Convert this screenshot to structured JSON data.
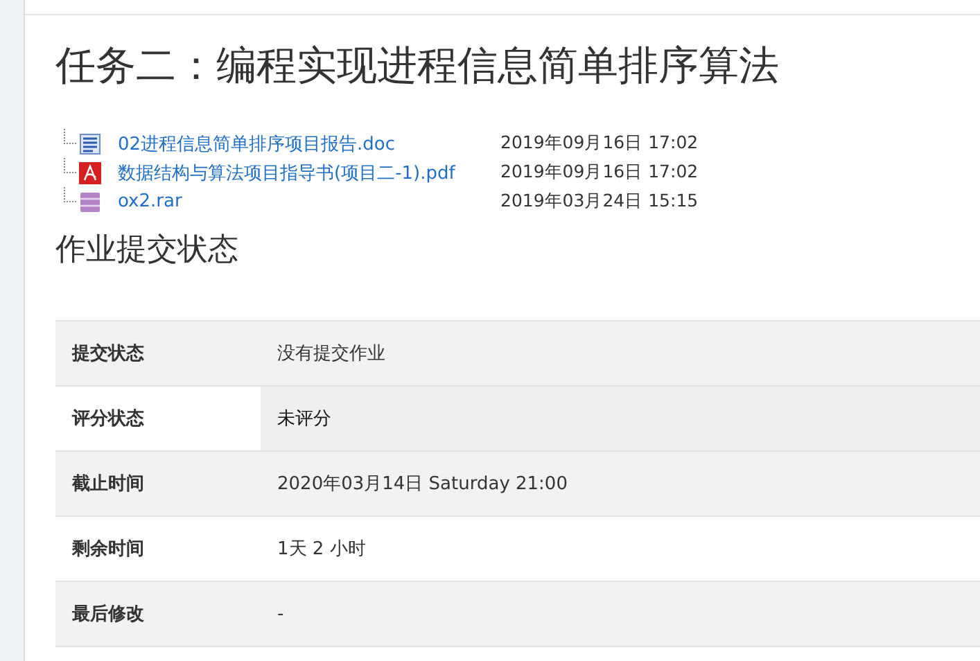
{
  "title": "任务二：编程实现进程信息简单排序算法",
  "files": [
    {
      "kind": "doc",
      "name": "02进程信息简单排序项目报告.doc",
      "date": "2019年09月16日 17:02"
    },
    {
      "kind": "pdf",
      "name": "数据结构与算法项目指导书(项目二-1).pdf",
      "date": "2019年09月16日 17:02"
    },
    {
      "kind": "archive",
      "name": "ox2.rar",
      "date": "2019年03月24日 15:15"
    }
  ],
  "section_title": "作业提交状态",
  "status_rows": [
    {
      "label": "提交状态",
      "value": "没有提交作业",
      "shaded": true,
      "highlighted": false
    },
    {
      "label": "评分状态",
      "value": "未评分",
      "shaded": false,
      "highlighted": true
    },
    {
      "label": "截止时间",
      "value": "2020年03月14日 Saturday 21:00",
      "shaded": true,
      "highlighted": false
    },
    {
      "label": "剩余时间",
      "value": "1天 2 小时",
      "shaded": false,
      "highlighted": false
    },
    {
      "label": "最后修改",
      "value": "-",
      "shaded": true,
      "highlighted": false
    }
  ]
}
